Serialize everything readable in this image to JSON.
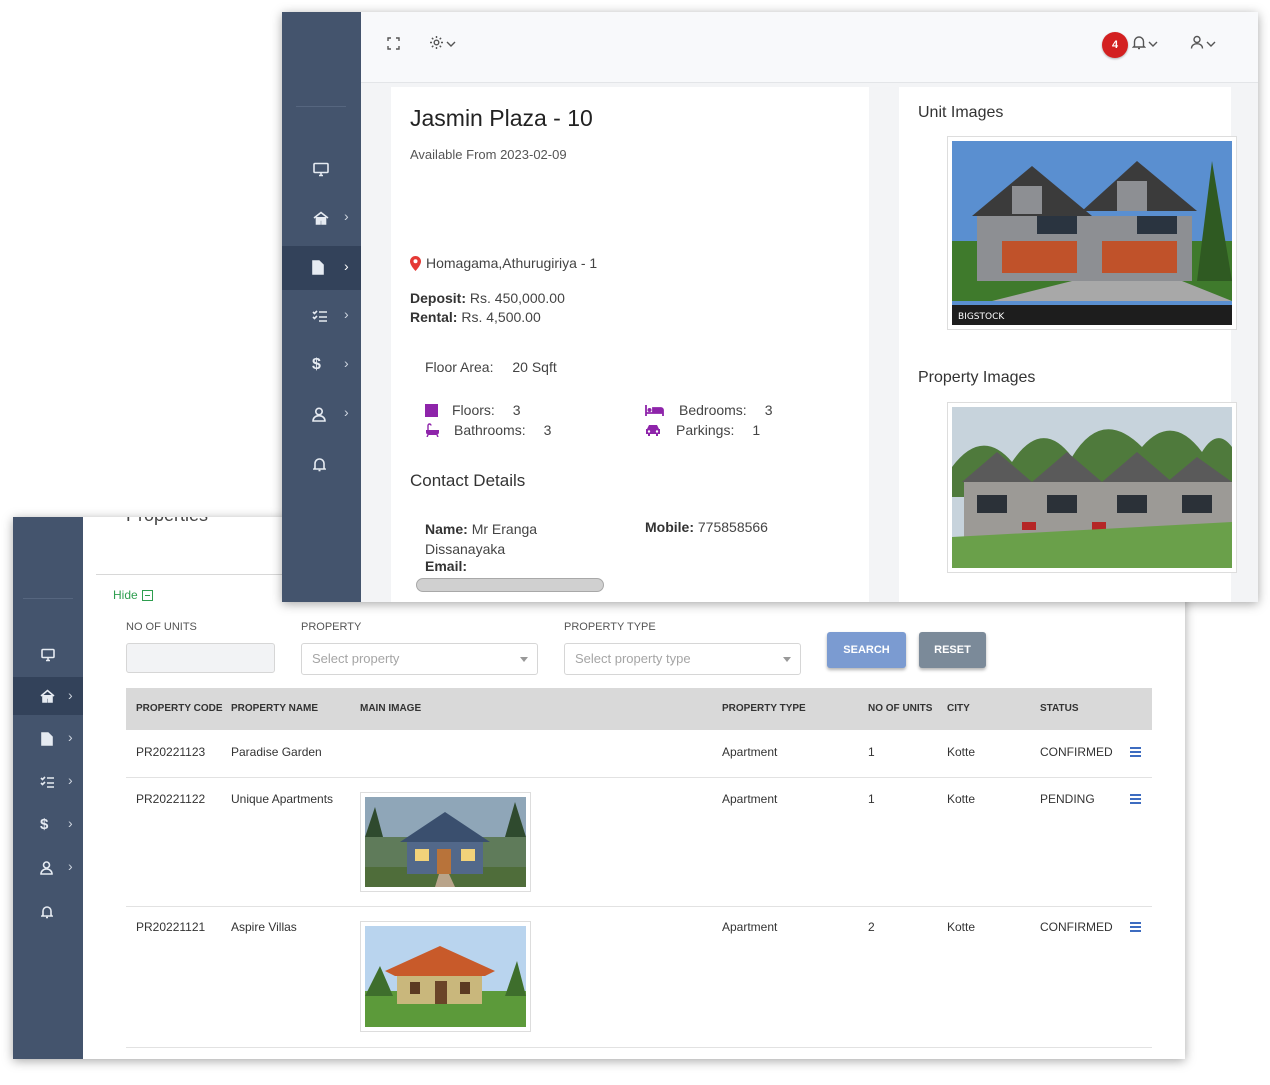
{
  "back_window": {
    "page_title": "Properties",
    "hide_label": "Hide",
    "filters": {
      "no_of_units_label": "NO OF UNITS",
      "property_label": "PROPERTY",
      "property_placeholder": "Select property",
      "property_type_label": "PROPERTY TYPE",
      "property_type_placeholder": "Select property type",
      "search_label": "SEARCH",
      "reset_label": "RESET"
    },
    "table": {
      "headers": [
        "PROPERTY CODE",
        "PROPERTY NAME",
        "MAIN IMAGE",
        "PROPERTY TYPE",
        "NO OF UNITS",
        "CITY",
        "STATUS"
      ],
      "rows": [
        {
          "code": "PR20221123",
          "name": "Paradise Garden",
          "type": "Apartment",
          "units": "1",
          "city": "Kotte",
          "status": "CONFIRMED",
          "image": "none"
        },
        {
          "code": "PR20221122",
          "name": "Unique Apartments",
          "type": "Apartment",
          "units": "1",
          "city": "Kotte",
          "status": "PENDING",
          "image": "blue-house"
        },
        {
          "code": "PR20221121",
          "name": "Aspire Villas",
          "type": "Apartment",
          "units": "2",
          "city": "Kotte",
          "status": "CONFIRMED",
          "image": "red-roof-house"
        }
      ]
    }
  },
  "front_window": {
    "notification_count": "4",
    "unit": {
      "title": "Jasmin Plaza - 10",
      "available_from": "Available From 2023-02-09",
      "location": "Homagama,Athurugiriya - 1",
      "deposit_label": "Deposit:",
      "deposit_value": "Rs. 450,000.00",
      "rental_label": "Rental:",
      "rental_value": "Rs. 4,500.00",
      "floor_area_label": "Floor Area:",
      "floor_area_value": "20 Sqft",
      "floors_label": "Floors:",
      "floors_value": "3",
      "bedrooms_label": "Bedrooms:",
      "bedrooms_value": "3",
      "bathrooms_label": "Bathrooms:",
      "bathrooms_value": "3",
      "parkings_label": "Parkings:",
      "parkings_value": "1"
    },
    "contact": {
      "heading": "Contact Details",
      "name_label": "Name:",
      "name_value": "Mr Eranga Dissanayaka",
      "mobile_label": "Mobile:",
      "mobile_value": "775858566",
      "email_label": "Email:"
    },
    "images": {
      "unit_images_heading": "Unit Images",
      "property_images_heading": "Property Images",
      "watermark": "BIGSTOCK"
    }
  },
  "colors": {
    "sidebar": "#44546d",
    "search_button": "#7b9bd1",
    "reset_button": "#7b8a99",
    "accent_purple": "#8e24aa",
    "badge_red": "#d32020",
    "hide_green": "#2e9e4f"
  }
}
